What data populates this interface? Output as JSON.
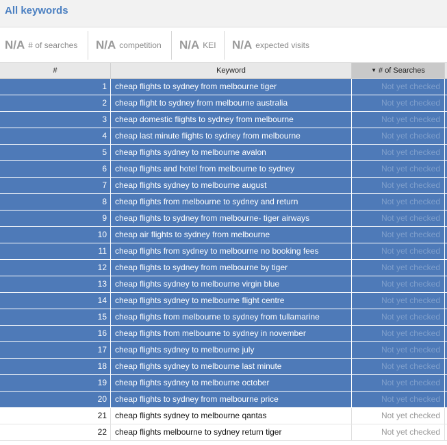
{
  "header": {
    "title": "All keywords"
  },
  "stats": [
    {
      "value": "N/A",
      "label": "# of searches"
    },
    {
      "value": "N/A",
      "label": "competition"
    },
    {
      "value": "N/A",
      "label": "KEI"
    },
    {
      "value": "N/A",
      "label": "expected visits"
    }
  ],
  "table": {
    "columns": {
      "num": "#",
      "keyword": "Keyword",
      "searches": "# of Searches"
    },
    "sort_indicator": "▼",
    "rows": [
      {
        "num": "1",
        "keyword": "cheap flights to sydney from melbourne tiger",
        "searches": "Not yet checked",
        "selected": true
      },
      {
        "num": "2",
        "keyword": "cheap flight to sydney from melbourne australia",
        "searches": "Not yet checked",
        "selected": true
      },
      {
        "num": "3",
        "keyword": "cheap domestic flights to sydney from melbourne",
        "searches": "Not yet checked",
        "selected": true
      },
      {
        "num": "4",
        "keyword": "cheap last minute flights to sydney from melbourne",
        "searches": "Not yet checked",
        "selected": true
      },
      {
        "num": "5",
        "keyword": "cheap flights sydney to melbourne avalon",
        "searches": "Not yet checked",
        "selected": true
      },
      {
        "num": "6",
        "keyword": "cheap flights and hotel from melbourne to sydney",
        "searches": "Not yet checked",
        "selected": true
      },
      {
        "num": "7",
        "keyword": "cheap flights sydney to melbourne august",
        "searches": "Not yet checked",
        "selected": true
      },
      {
        "num": "8",
        "keyword": "cheap flights from melbourne to sydney and return",
        "searches": "Not yet checked",
        "selected": true
      },
      {
        "num": "9",
        "keyword": "cheap flights to sydney from melbourne- tiger airways",
        "searches": "Not yet checked",
        "selected": true
      },
      {
        "num": "10",
        "keyword": "cheap air flights to sydney from melbourne",
        "searches": "Not yet checked",
        "selected": true
      },
      {
        "num": "11",
        "keyword": "cheap flights from sydney to melbourne no booking fees",
        "searches": "Not yet checked",
        "selected": true
      },
      {
        "num": "12",
        "keyword": "cheap flights to sydney from melbourne by tiger",
        "searches": "Not yet checked",
        "selected": true
      },
      {
        "num": "13",
        "keyword": "cheap flights sydney to melbourne virgin blue",
        "searches": "Not yet checked",
        "selected": true
      },
      {
        "num": "14",
        "keyword": "cheap flights sydney to melbourne flight centre",
        "searches": "Not yet checked",
        "selected": true
      },
      {
        "num": "15",
        "keyword": "cheap flights from melbourne to sydney from tullamarine",
        "searches": "Not yet checked",
        "selected": true
      },
      {
        "num": "16",
        "keyword": "cheap flights from melbourne to sydney in november",
        "searches": "Not yet checked",
        "selected": true
      },
      {
        "num": "17",
        "keyword": "cheap flights sydney to melbourne july",
        "searches": "Not yet checked",
        "selected": true
      },
      {
        "num": "18",
        "keyword": "cheap flights sydney to melbourne last minute",
        "searches": "Not yet checked",
        "selected": true
      },
      {
        "num": "19",
        "keyword": "cheap flights sydney to melbourne october",
        "searches": "Not yet checked",
        "selected": true
      },
      {
        "num": "20",
        "keyword": "cheap flights to sydney from melbourne price",
        "searches": "Not yet checked",
        "selected": true
      },
      {
        "num": "21",
        "keyword": "cheap flights sydney to melbourne qantas",
        "searches": "Not yet checked",
        "selected": false
      },
      {
        "num": "22",
        "keyword": "cheap flights melbourne to sydney return tiger",
        "searches": "Not yet checked",
        "selected": false
      }
    ]
  },
  "colors": {
    "accent": "#4a7fc1",
    "selected_row": "#4e7ab8",
    "sorted_header": "#c9c9c9"
  }
}
